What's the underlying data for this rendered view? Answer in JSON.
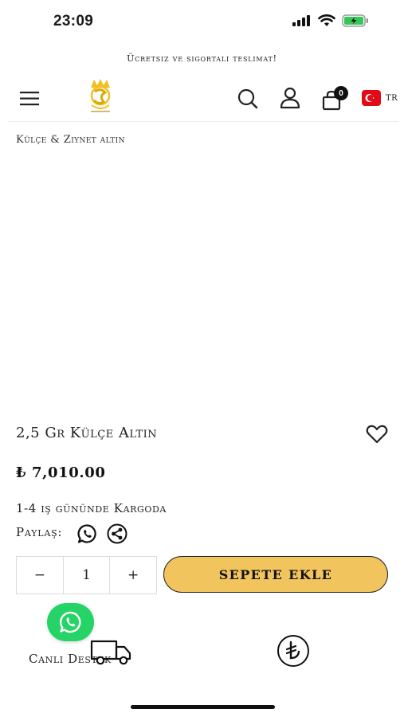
{
  "status_bar": {
    "time": "23:09"
  },
  "announcement": "Ücretsiz ve sigortalı teslimat!",
  "header": {
    "cart_count": "0",
    "language": "TR"
  },
  "breadcrumb": "Külçe & Ziynet altın",
  "product": {
    "title": "2,5 Gr Külçe Altın",
    "price": "₺ 7,010.00",
    "shipping": "1-4 iş gününde Kargoda",
    "share_label": "Paylaş:",
    "quantity": "1",
    "decrement": "−",
    "increment": "+",
    "add_to_cart": "SEPETE EKLE"
  },
  "footer": {
    "live_support": "Canlı Destek"
  },
  "colors": {
    "accent": "#f2c45d",
    "whatsapp": "#25d366",
    "battery": "#35c759",
    "flag_red": "#e30a17"
  },
  "icons": [
    "menu-icon",
    "search-icon",
    "account-icon",
    "cart-icon",
    "heart-icon",
    "whatsapp-icon",
    "share-icon",
    "truck-icon",
    "lira-icon"
  ]
}
